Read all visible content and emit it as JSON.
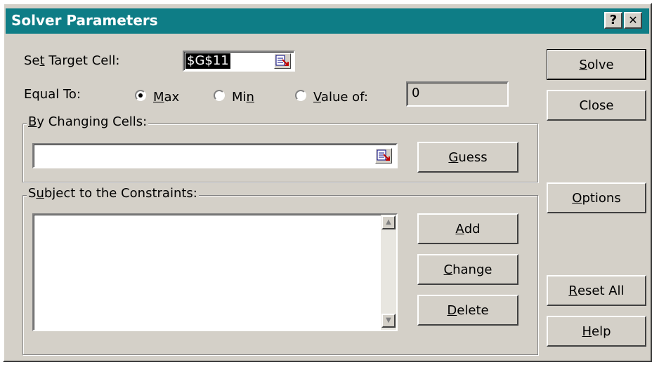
{
  "window": {
    "title": "Solver Parameters",
    "help_glyph": "?",
    "close_glyph": "✕"
  },
  "target": {
    "label_pre": "Se",
    "label_key": "t",
    "label_post": " Target Cell:",
    "value": "$G$11"
  },
  "equal_to": {
    "label": "Equal To:",
    "options": [
      {
        "pre": "",
        "key": "M",
        "post": "ax",
        "checked": true
      },
      {
        "pre": "Mi",
        "key": "n",
        "post": "",
        "checked": false
      },
      {
        "pre": "",
        "key": "V",
        "post": "alue of:",
        "checked": false
      }
    ],
    "value_of": "0"
  },
  "changing_cells": {
    "label_pre": "",
    "label_key": "B",
    "label_post": "y Changing Cells:",
    "value": ""
  },
  "constraints": {
    "label_pre": "S",
    "label_key": "u",
    "label_post": "bject to the Constraints:",
    "items": []
  },
  "buttons": {
    "solve": {
      "pre": "",
      "key": "S",
      "post": "olve"
    },
    "close": {
      "pre": "Close",
      "key": "",
      "post": ""
    },
    "guess": {
      "pre": "",
      "key": "G",
      "post": "uess"
    },
    "options": {
      "pre": "",
      "key": "O",
      "post": "ptions"
    },
    "add": {
      "pre": "",
      "key": "A",
      "post": "dd"
    },
    "change": {
      "pre": "",
      "key": "C",
      "post": "hange"
    },
    "delete": {
      "pre": "",
      "key": "D",
      "post": "elete"
    },
    "reset_all": {
      "pre": "",
      "key": "R",
      "post": "eset All"
    },
    "help": {
      "pre": "",
      "key": "H",
      "post": "elp"
    }
  },
  "colors": {
    "title_bar": "#0e7d86",
    "face": "#d4d0c8"
  }
}
